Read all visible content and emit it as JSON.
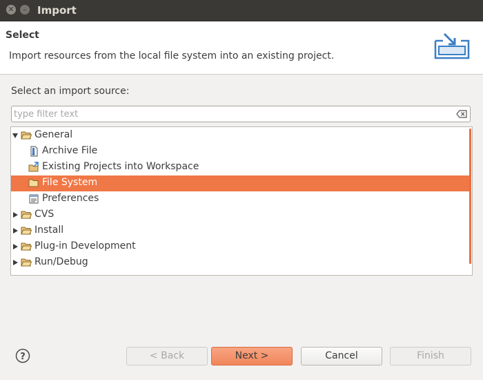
{
  "window": {
    "title": "Import"
  },
  "header": {
    "title": "Select",
    "description": "Import resources from the local file system into an existing project."
  },
  "source": {
    "label": "Select an import source:",
    "filter_placeholder": "type filter text",
    "filter_value": ""
  },
  "tree": {
    "items": [
      {
        "label": "General",
        "type": "folder",
        "expanded": true,
        "depth": 0,
        "icon": "folder-open-icon"
      },
      {
        "label": "Archive File",
        "type": "item",
        "depth": 1,
        "icon": "archive-file-icon"
      },
      {
        "label": "Existing Projects into Workspace",
        "type": "item",
        "depth": 1,
        "icon": "existing-projects-icon"
      },
      {
        "label": "File System",
        "type": "item",
        "depth": 1,
        "icon": "file-system-folder-icon",
        "selected": true
      },
      {
        "label": "Preferences",
        "type": "item",
        "depth": 1,
        "icon": "preferences-icon"
      },
      {
        "label": "CVS",
        "type": "folder",
        "expanded": false,
        "depth": 0,
        "icon": "folder-icon"
      },
      {
        "label": "Install",
        "type": "folder",
        "expanded": false,
        "depth": 0,
        "icon": "folder-icon"
      },
      {
        "label": "Plug-in Development",
        "type": "folder",
        "expanded": false,
        "depth": 0,
        "icon": "folder-icon"
      },
      {
        "label": "Run/Debug",
        "type": "folder",
        "expanded": false,
        "depth": 0,
        "icon": "folder-icon"
      }
    ]
  },
  "buttons": {
    "back": "< Back",
    "next": "Next >",
    "cancel": "Cancel",
    "finish": "Finish"
  },
  "colors": {
    "accent": "#f07746",
    "titlebar": "#3a3935",
    "dialog_bg": "#f2f1f0"
  }
}
